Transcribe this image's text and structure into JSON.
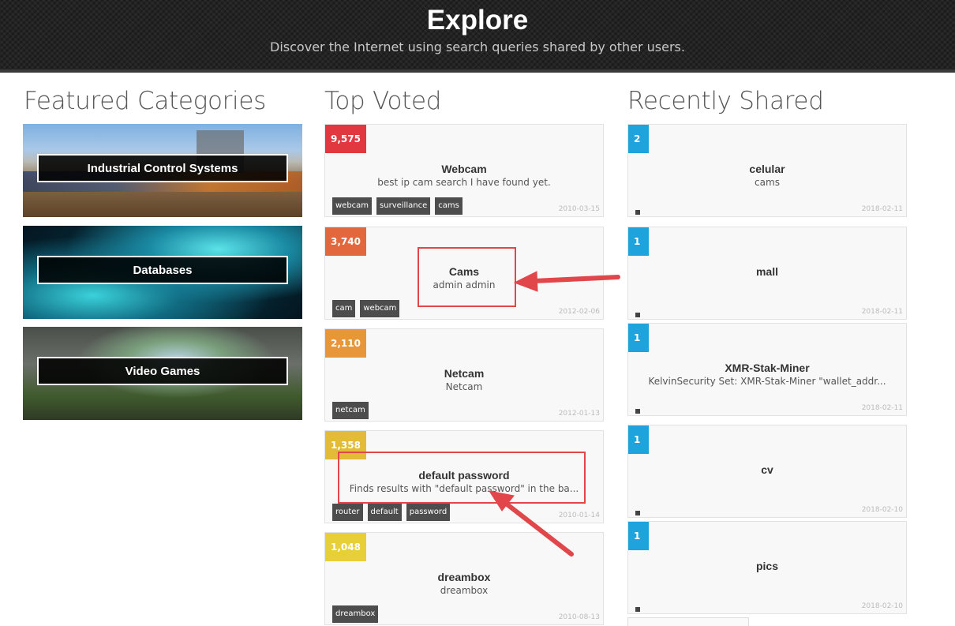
{
  "header": {
    "title": "Explore",
    "subtitle": "Discover the Internet using search queries shared by other users."
  },
  "columns": {
    "featured": "Featured Categories",
    "top_voted": "Top Voted",
    "recent": "Recently Shared"
  },
  "categories": [
    {
      "label": "Industrial Control Systems"
    },
    {
      "label": "Databases"
    },
    {
      "label": "Video Games"
    }
  ],
  "top_voted": [
    {
      "votes": "9,575",
      "color": "#e0383e",
      "title": "Webcam",
      "desc": "best ip cam search I have found yet.",
      "tags": [
        "webcam",
        "surveillance",
        "cams"
      ],
      "date": "2010-03-15"
    },
    {
      "votes": "3,740",
      "color": "#e3673c",
      "title": "Cams",
      "desc": "admin admin",
      "tags": [
        "cam",
        "webcam"
      ],
      "date": "2012-02-06"
    },
    {
      "votes": "2,110",
      "color": "#e8963a",
      "title": "Netcam",
      "desc": "Netcam",
      "tags": [
        "netcam"
      ],
      "date": "2012-01-13"
    },
    {
      "votes": "1,358",
      "color": "#e3bb36",
      "title": "default password",
      "desc": "Finds results with \"default password\" in the ba...",
      "tags": [
        "router",
        "default",
        "password"
      ],
      "date": "2010-01-14"
    },
    {
      "votes": "1,048",
      "color": "#e6cf37",
      "title": "dreambox",
      "desc": "dreambox",
      "tags": [
        "dreambox"
      ],
      "date": "2010-08-13"
    }
  ],
  "recent": [
    {
      "votes": "2",
      "title": "celular",
      "desc": "cams",
      "date": "2018-02-11"
    },
    {
      "votes": "1",
      "title": "mall",
      "desc": "",
      "date": "2018-02-11"
    },
    {
      "votes": "1",
      "title": "XMR-Stak-Miner",
      "desc": "KelvinSecurity Set: XMR-Stak-Miner \"wallet_addr...",
      "date": "2018-02-11"
    },
    {
      "votes": "1",
      "title": "cv",
      "desc": "",
      "date": "2018-02-10"
    },
    {
      "votes": "1",
      "title": "pics",
      "desc": "",
      "date": "2018-02-10"
    }
  ],
  "colors": {
    "recent_badge": "#1fa3dc",
    "annotation": "#e0464a"
  }
}
